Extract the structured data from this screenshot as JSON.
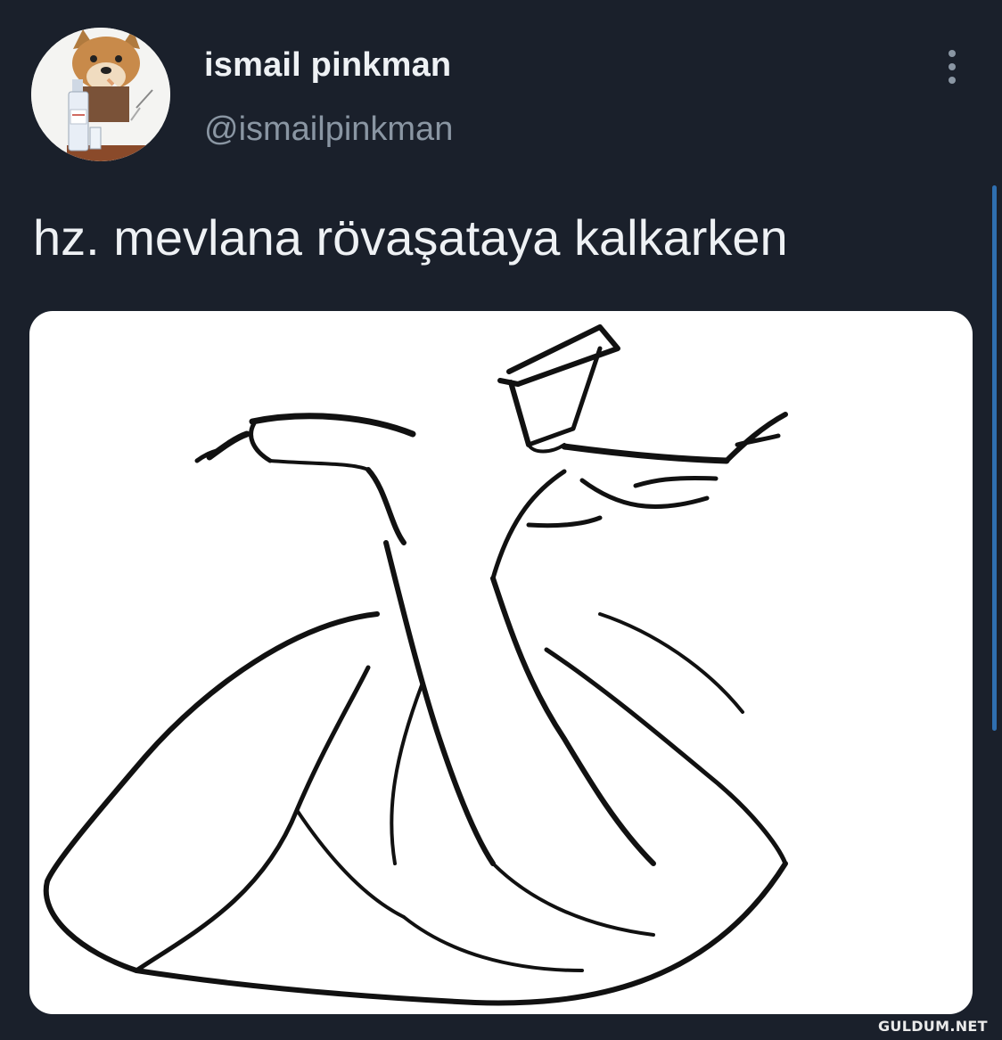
{
  "tweet": {
    "author": {
      "display_name": "ismail pinkman",
      "handle": "@ismailpinkman",
      "avatar_icon": "dog-avatar-icon"
    },
    "text": "hz. mevlana rövaşataya kalkarken",
    "media": {
      "description_icon": "whirling-dervish-drawing"
    },
    "menu_icon": "more-vertical-icon"
  },
  "watermark": {
    "text": "GULDUM.NET"
  },
  "colors": {
    "background": "#1a202b",
    "primary_text": "#eef1f4",
    "secondary_text": "#8a96a3",
    "scrollbar": "#2f6fb0"
  }
}
